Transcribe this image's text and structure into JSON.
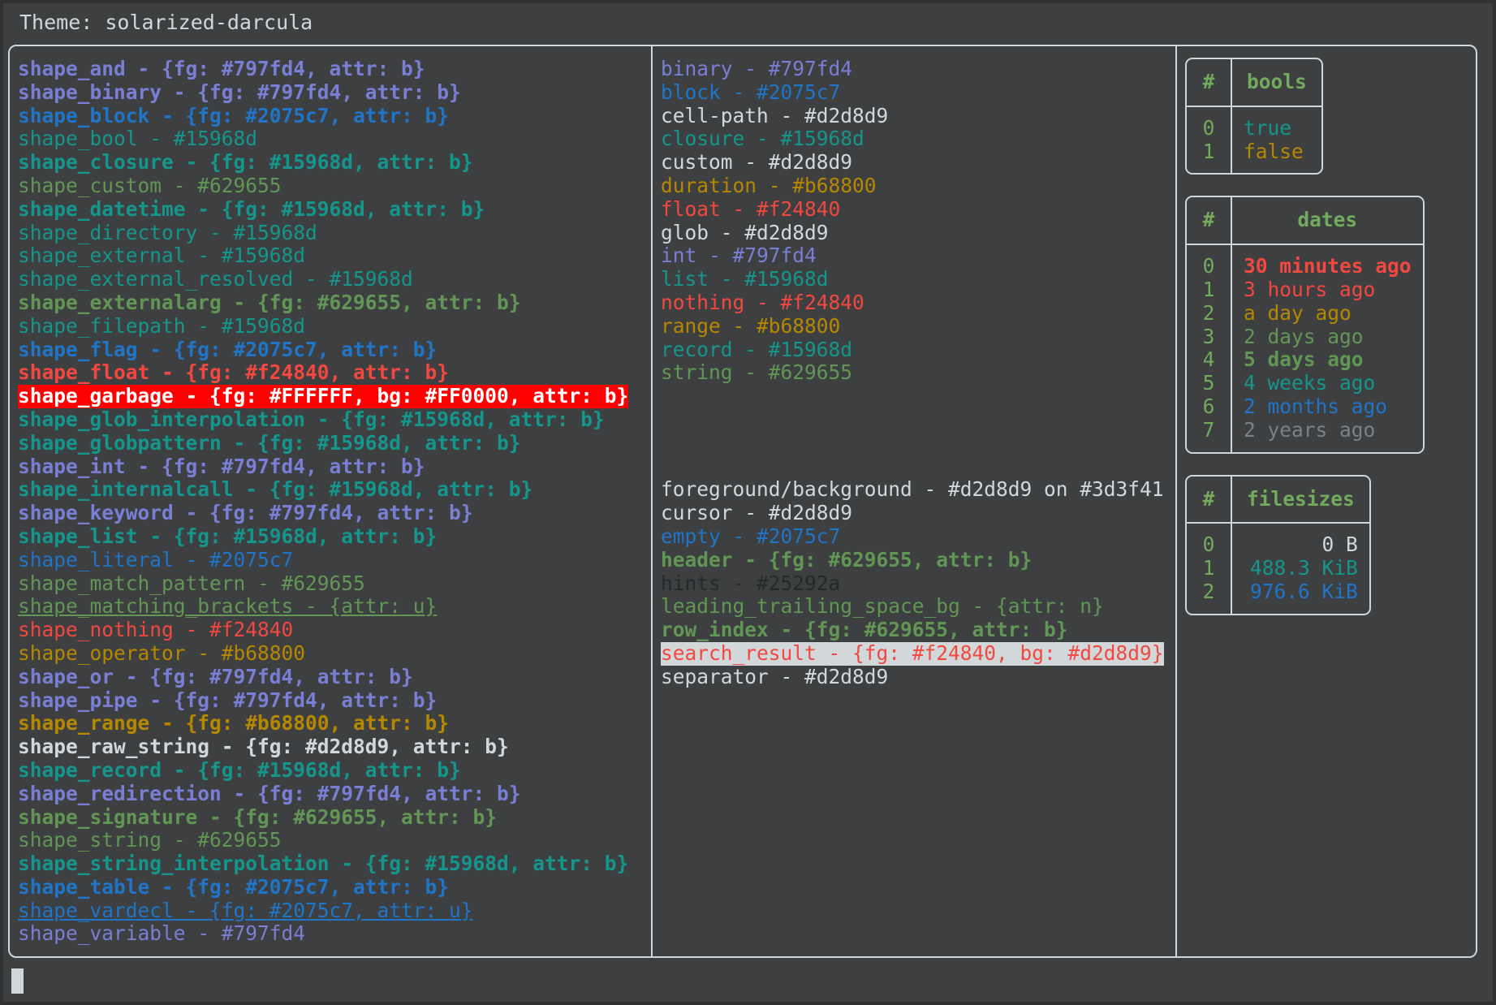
{
  "header": {
    "label": "Theme: solarized-darcula"
  },
  "colors": {
    "fg": "#d2d8d9",
    "bg": "#3d3f41",
    "outer_bg": "#2f3133",
    "border": "#cfd6d8",
    "purple": "#797fd4",
    "blue": "#2075c7",
    "teal": "#15968d",
    "green": "#629655",
    "green_header": "#72ab5b",
    "yellow": "#b68800",
    "red": "#f24840",
    "hints": "#25292a",
    "garbage_fg": "#FFFFFF",
    "garbage_bg": "#FF0000",
    "search_bg": "#d2d8d9"
  },
  "shapes": {
    "title": "shapes-column",
    "lines": [
      {
        "text": "shape_and - {fg: #797fd4, attr: b}",
        "color": "#797fd4",
        "bold": true
      },
      {
        "text": "shape_binary - {fg: #797fd4, attr: b}",
        "color": "#797fd4",
        "bold": true
      },
      {
        "text": "shape_block - {fg: #2075c7, attr: b}",
        "color": "#2075c7",
        "bold": true
      },
      {
        "text": "shape_bool - #15968d",
        "color": "#15968d",
        "bold": false
      },
      {
        "text": "shape_closure - {fg: #15968d, attr: b}",
        "color": "#15968d",
        "bold": true
      },
      {
        "text": "shape_custom - #629655",
        "color": "#629655",
        "bold": false
      },
      {
        "text": "shape_datetime - {fg: #15968d, attr: b}",
        "color": "#15968d",
        "bold": true
      },
      {
        "text": "shape_directory - #15968d",
        "color": "#15968d",
        "bold": false
      },
      {
        "text": "shape_external - #15968d",
        "color": "#15968d",
        "bold": false
      },
      {
        "text": "shape_external_resolved - #15968d",
        "color": "#15968d",
        "bold": false
      },
      {
        "text": "shape_externalarg - {fg: #629655, attr: b}",
        "color": "#629655",
        "bold": true
      },
      {
        "text": "shape_filepath - #15968d",
        "color": "#15968d",
        "bold": false
      },
      {
        "text": "shape_flag - {fg: #2075c7, attr: b}",
        "color": "#2075c7",
        "bold": true
      },
      {
        "text": "shape_float - {fg: #f24840, attr: b}",
        "color": "#f24840",
        "bold": true
      },
      {
        "text": "shape_garbage - {fg: #FFFFFF, bg: #FF0000, attr: b}",
        "color": "#FFFFFF",
        "bg": "#FF0000",
        "bold": true
      },
      {
        "text": "shape_glob_interpolation - {fg: #15968d, attr: b}",
        "color": "#15968d",
        "bold": true
      },
      {
        "text": "shape_globpattern - {fg: #15968d, attr: b}",
        "color": "#15968d",
        "bold": true
      },
      {
        "text": "shape_int - {fg: #797fd4, attr: b}",
        "color": "#797fd4",
        "bold": true
      },
      {
        "text": "shape_internalcall - {fg: #15968d, attr: b}",
        "color": "#15968d",
        "bold": true
      },
      {
        "text": "shape_keyword - {fg: #797fd4, attr: b}",
        "color": "#797fd4",
        "bold": true
      },
      {
        "text": "shape_list - {fg: #15968d, attr: b}",
        "color": "#15968d",
        "bold": true
      },
      {
        "text": "shape_literal - #2075c7",
        "color": "#2075c7",
        "bold": false
      },
      {
        "text": "shape_match_pattern - #629655",
        "color": "#629655",
        "bold": false
      },
      {
        "text": "shape_matching_brackets - {attr: u}",
        "color": "#629655",
        "bold": false,
        "underline": true
      },
      {
        "text": "shape_nothing - #f24840",
        "color": "#f24840",
        "bold": false
      },
      {
        "text": "shape_operator - #b68800",
        "color": "#b68800",
        "bold": false
      },
      {
        "text": "shape_or - {fg: #797fd4, attr: b}",
        "color": "#797fd4",
        "bold": true
      },
      {
        "text": "shape_pipe - {fg: #797fd4, attr: b}",
        "color": "#797fd4",
        "bold": true
      },
      {
        "text": "shape_range - {fg: #b68800, attr: b}",
        "color": "#b68800",
        "bold": true
      },
      {
        "text": "shape_raw_string - {fg: #d2d8d9, attr: b}",
        "color": "#d2d8d9",
        "bold": true
      },
      {
        "text": "shape_record - {fg: #15968d, attr: b}",
        "color": "#15968d",
        "bold": true
      },
      {
        "text": "shape_redirection - {fg: #797fd4, attr: b}",
        "color": "#797fd4",
        "bold": true
      },
      {
        "text": "shape_signature - {fg: #629655, attr: b}",
        "color": "#629655",
        "bold": true
      },
      {
        "text": "shape_string - #629655",
        "color": "#629655",
        "bold": false
      },
      {
        "text": "shape_string_interpolation - {fg: #15968d, attr: b}",
        "color": "#15968d",
        "bold": true
      },
      {
        "text": "shape_table - {fg: #2075c7, attr: b}",
        "color": "#2075c7",
        "bold": true
      },
      {
        "text": "shape_vardecl - {fg: #2075c7, attr: u}",
        "color": "#2075c7",
        "bold": false,
        "underline": true
      },
      {
        "text": "shape_variable - #797fd4",
        "color": "#797fd4",
        "bold": false
      }
    ]
  },
  "types": {
    "title": "types-column",
    "lines": [
      {
        "text": "binary - #797fd4",
        "color": "#797fd4",
        "bold": false
      },
      {
        "text": "block - #2075c7",
        "color": "#2075c7",
        "bold": false
      },
      {
        "text": "cell-path - #d2d8d9",
        "color": "#d2d8d9",
        "bold": false
      },
      {
        "text": "closure - #15968d",
        "color": "#15968d",
        "bold": false
      },
      {
        "text": "custom - #d2d8d9",
        "color": "#d2d8d9",
        "bold": false
      },
      {
        "text": "duration - #b68800",
        "color": "#b68800",
        "bold": false
      },
      {
        "text": "float - #f24840",
        "color": "#f24840",
        "bold": false
      },
      {
        "text": "glob - #d2d8d9",
        "color": "#d2d8d9",
        "bold": false
      },
      {
        "text": "int - #797fd4",
        "color": "#797fd4",
        "bold": false
      },
      {
        "text": "list - #15968d",
        "color": "#15968d",
        "bold": false
      },
      {
        "text": "nothing - #f24840",
        "color": "#f24840",
        "bold": false
      },
      {
        "text": "range - #b68800",
        "color": "#b68800",
        "bold": false
      },
      {
        "text": "record - #15968d",
        "color": "#15968d",
        "bold": false
      },
      {
        "text": "string - #629655",
        "color": "#629655",
        "bold": false
      }
    ],
    "ui_lines": [
      {
        "text": "foreground/background - #d2d8d9 on #3d3f41",
        "color": "#d2d8d9",
        "bold": false
      },
      {
        "text": "cursor - #d2d8d9",
        "color": "#d2d8d9",
        "bold": false
      },
      {
        "text": "empty - #2075c7",
        "color": "#2075c7",
        "bold": false
      },
      {
        "text": "header - {fg: #629655, attr: b}",
        "color": "#629655",
        "bold": true
      },
      {
        "text": "hints - #25292a",
        "color": "#25292a",
        "bold": false
      },
      {
        "text": "leading_trailing_space_bg - {attr: n}",
        "color": "#629655",
        "bold": false
      },
      {
        "text": "row_index - {fg: #629655, attr: b}",
        "color": "#629655",
        "bold": true
      },
      {
        "text": "search_result - {fg: #f24840, bg: #d2d8d9}",
        "color": "#f24840",
        "bg": "#d2d8d9",
        "bold": false
      },
      {
        "text": "separator - #d2d8d9",
        "color": "#d2d8d9",
        "bold": false
      }
    ]
  },
  "tables": [
    {
      "name": "bools",
      "index_header": "#",
      "value_header": "bools",
      "align": "left",
      "rows": [
        {
          "index": "0",
          "value": "true",
          "color": "#15968d",
          "bold": false
        },
        {
          "index": "1",
          "value": "false",
          "color": "#b68800",
          "bold": false
        }
      ]
    },
    {
      "name": "dates",
      "index_header": "#",
      "value_header": "dates",
      "align": "left",
      "rows": [
        {
          "index": "0",
          "value": "30 minutes ago",
          "color": "#f24840",
          "bold": true
        },
        {
          "index": "1",
          "value": "3 hours ago",
          "color": "#f24840",
          "bold": false
        },
        {
          "index": "2",
          "value": "a day ago",
          "color": "#b68800",
          "bold": false
        },
        {
          "index": "3",
          "value": "2 days ago",
          "color": "#629655",
          "bold": false
        },
        {
          "index": "4",
          "value": "5 days ago",
          "color": "#629655",
          "bold": true
        },
        {
          "index": "5",
          "value": "4 weeks ago",
          "color": "#15968d",
          "bold": false
        },
        {
          "index": "6",
          "value": "2 months ago",
          "color": "#2075c7",
          "bold": false
        },
        {
          "index": "7",
          "value": "2 years ago",
          "color": "#7a8286",
          "bold": false
        }
      ]
    },
    {
      "name": "filesizes",
      "index_header": "#",
      "value_header": "filesizes",
      "align": "right",
      "rows": [
        {
          "index": "0",
          "value": "0 B",
          "color": "#d2d8d9",
          "bold": false
        },
        {
          "index": "1",
          "value": "488.3 KiB",
          "color": "#15968d",
          "bold": false
        },
        {
          "index": "2",
          "value": "976.6 KiB",
          "color": "#2075c7",
          "bold": false
        }
      ]
    }
  ],
  "cursor": {
    "label": "terminal-cursor"
  }
}
